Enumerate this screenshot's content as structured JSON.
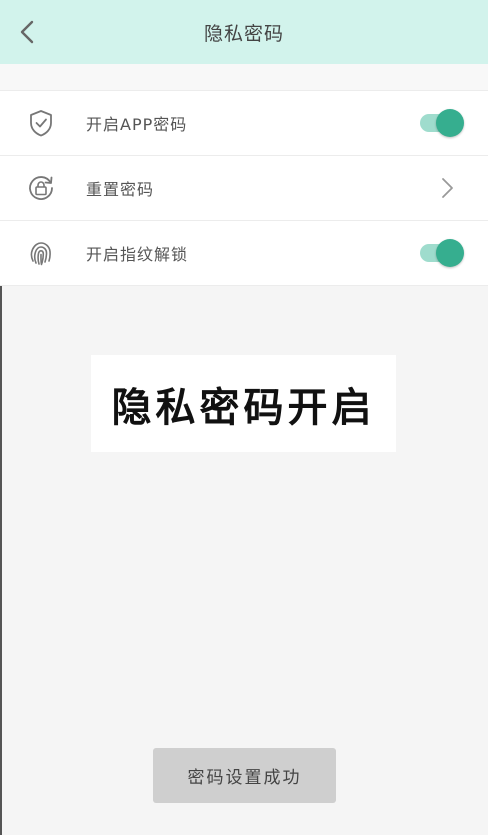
{
  "header": {
    "title": "隐私密码",
    "back_icon": "chevron-left-icon"
  },
  "settings": {
    "items": [
      {
        "label": "开启APP密码",
        "icon": "shield-check-icon",
        "control": "toggle",
        "on": true
      },
      {
        "label": "重置密码",
        "icon": "lock-reset-icon",
        "control": "chevron"
      },
      {
        "label": "开启指纹解锁",
        "icon": "fingerprint-icon",
        "control": "toggle",
        "on": true
      }
    ]
  },
  "banner": {
    "text": "隐私密码开启"
  },
  "toast": {
    "text": "密码设置成功"
  },
  "colors": {
    "header_bg": "#d2f3ec",
    "toggle_on": "#36ae8f",
    "toggle_track": "#9fdccd",
    "toast_bg": "#cfcfcf"
  }
}
